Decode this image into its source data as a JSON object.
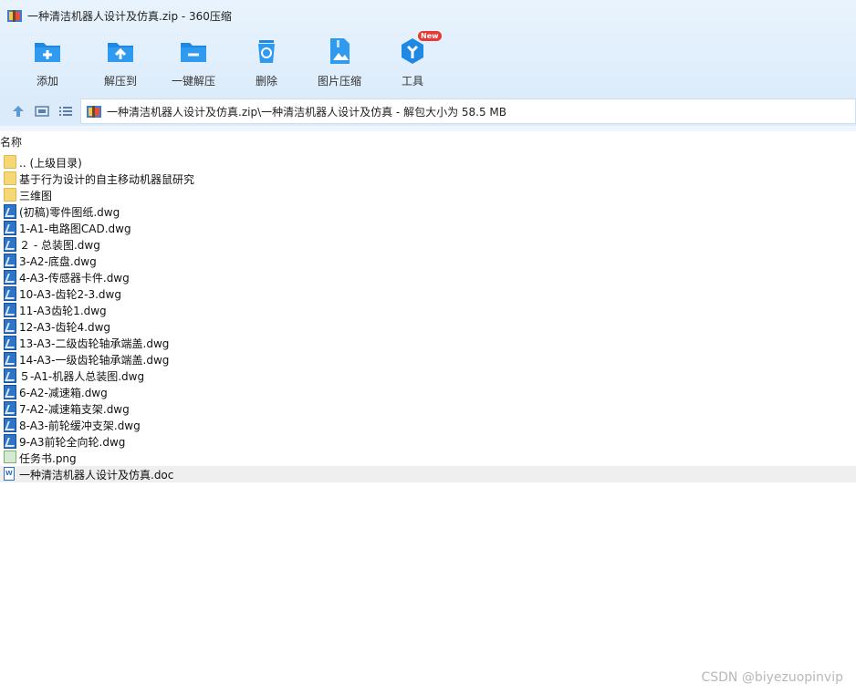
{
  "window": {
    "title": "一种清洁机器人设计及仿真.zip - 360压缩",
    "app_icon": "zip-archive-icon"
  },
  "toolbar": {
    "buttons": [
      {
        "label": "添加",
        "icon": "add-folder-icon"
      },
      {
        "label": "解压到",
        "icon": "extract-to-icon"
      },
      {
        "label": "一键解压",
        "icon": "one-click-extract-icon"
      },
      {
        "label": "删除",
        "icon": "recycle-bin-icon"
      },
      {
        "label": "图片压缩",
        "icon": "image-compress-icon"
      },
      {
        "label": "工具",
        "icon": "tools-icon",
        "badge": "New"
      }
    ]
  },
  "address": {
    "path": "一种清洁机器人设计及仿真.zip\\一种清洁机器人设计及仿真 - 解包大小为 58.5 MB"
  },
  "list": {
    "column_name": "名称",
    "items": [
      {
        "name": ".. (上级目录)",
        "type": "folder"
      },
      {
        "name": "基于行为设计的自主移动机器鼠研究",
        "type": "folder"
      },
      {
        "name": "三维图",
        "type": "folder"
      },
      {
        "name": "(初稿)零件图纸.dwg",
        "type": "dwg"
      },
      {
        "name": "1-A1-电路图CAD.dwg",
        "type": "dwg"
      },
      {
        "name": "２ - 总装图.dwg",
        "type": "dwg"
      },
      {
        "name": "3-A2-底盘.dwg",
        "type": "dwg"
      },
      {
        "name": "4-A3-传感器卡件.dwg",
        "type": "dwg"
      },
      {
        "name": "10-A3-齿轮2-3.dwg",
        "type": "dwg"
      },
      {
        "name": "11-A3齿轮1.dwg",
        "type": "dwg"
      },
      {
        "name": "12-A3-齿轮4.dwg",
        "type": "dwg"
      },
      {
        "name": "13-A3-二级齿轮轴承端盖.dwg",
        "type": "dwg"
      },
      {
        "name": "14-A3-一级齿轮轴承端盖.dwg",
        "type": "dwg"
      },
      {
        "name": "５-A1-机器人总装图.dwg",
        "type": "dwg"
      },
      {
        "name": "6-A2-减速箱.dwg",
        "type": "dwg"
      },
      {
        "name": "7-A2-减速箱支架.dwg",
        "type": "dwg"
      },
      {
        "name": "8-A3-前轮缓冲支架.dwg",
        "type": "dwg"
      },
      {
        "name": "9-A3前轮全向轮.dwg",
        "type": "dwg"
      },
      {
        "name": "任务书.png",
        "type": "png"
      },
      {
        "name": "一种清洁机器人设计及仿真.doc",
        "type": "doc",
        "selected": true
      }
    ]
  },
  "watermark": "CSDN @biyezuopinvip",
  "colors": {
    "accent": "#1e88e5",
    "toolbar_bg": "#dcecfb",
    "folder": "#f6d776",
    "badge": "#e53935"
  }
}
